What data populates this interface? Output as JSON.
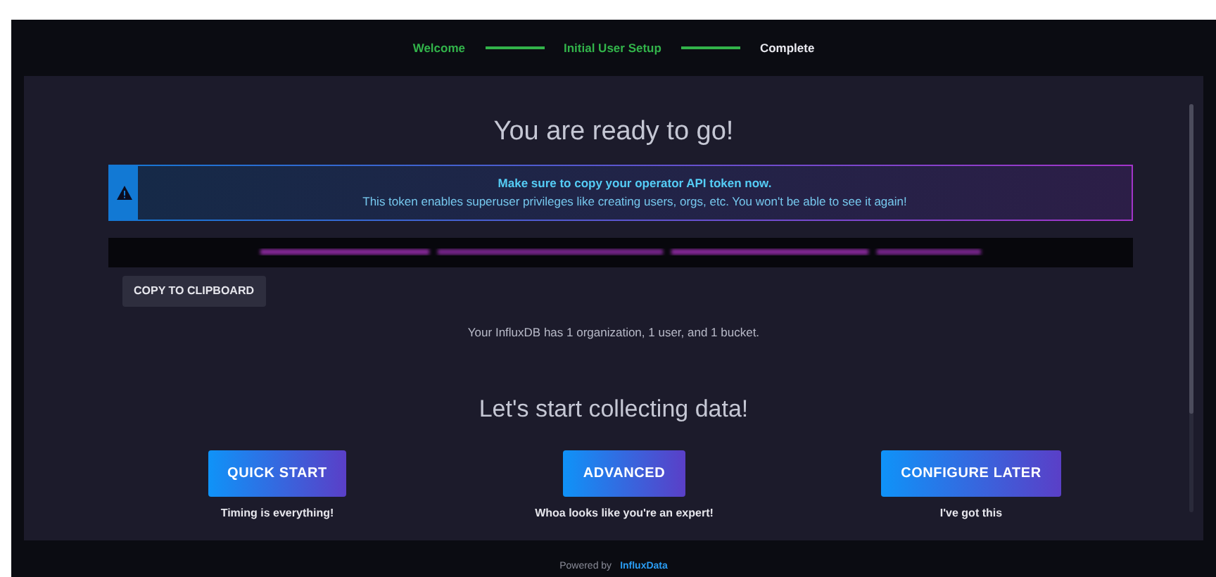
{
  "steps": [
    {
      "label": "Welcome",
      "completed": true
    },
    {
      "label": "Initial User Setup",
      "completed": true
    },
    {
      "label": "Complete",
      "completed": false
    }
  ],
  "title": "You are ready to go!",
  "alert": {
    "heading": "Make sure to copy your operator API token now.",
    "text": "This token enables superuser privileges like creating users, orgs, etc. You won't be able to see it again!"
  },
  "copy_button": "COPY TO CLIPBOARD",
  "summary": "Your InfluxDB has 1 organization, 1 user, and 1 bucket.",
  "subtitle": "Let's start collecting data!",
  "options": [
    {
      "button": "QUICK START",
      "caption": "Timing is everything!"
    },
    {
      "button": "ADVANCED",
      "caption": "Whoa looks like you're an expert!"
    },
    {
      "button": "CONFIGURE LATER",
      "caption": "I've got this"
    }
  ],
  "footer": {
    "prefix": "Powered by",
    "brand": "InfluxData"
  }
}
